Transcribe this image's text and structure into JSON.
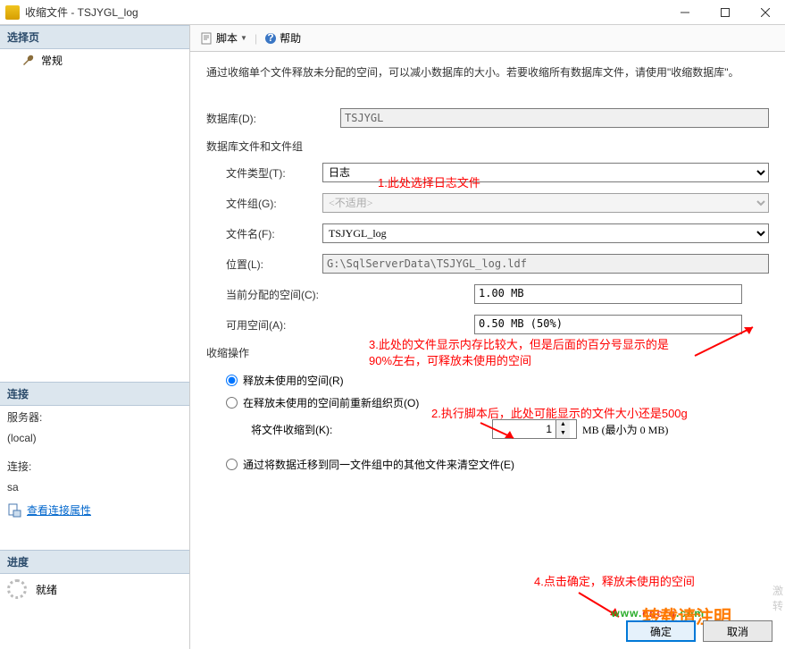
{
  "window": {
    "title": "收缩文件 - TSJYGL_log"
  },
  "left": {
    "select_page": "选择页",
    "general": "常规",
    "connection": "连接",
    "server_lbl": "服务器:",
    "server_val": "(local)",
    "conn_lbl": "连接:",
    "conn_val": "sa",
    "view_props": "查看连接属性",
    "progress": "进度",
    "ready": "就绪"
  },
  "toolbar": {
    "script": "脚本",
    "help": "帮助"
  },
  "form": {
    "desc": "通过收缩单个文件释放未分配的空间，可以减小数据库的大小。若要收缩所有数据库文件，请使用\"收缩数据库\"。",
    "db_lbl": "数据库(D):",
    "db_val": "TSJYGL",
    "group1": "数据库文件和文件组",
    "filetype_lbl": "文件类型(T):",
    "filetype_val": "日志",
    "filegroup_lbl": "文件组(G):",
    "filegroup_val": "<不适用>",
    "filename_lbl": "文件名(F):",
    "filename_val": "TSJYGL_log",
    "location_lbl": "位置(L):",
    "location_val": "G:\\SqlServerData\\TSJYGL_log.ldf",
    "alloc_lbl": "当前分配的空间(C):",
    "alloc_val": "1.00 MB",
    "avail_lbl": "可用空间(A):",
    "avail_val": "0.50 MB (50%)",
    "shrink_ops": "收缩操作",
    "radio1": "释放未使用的空间(R)",
    "radio2": "在释放未使用的空间前重新组织页(O)",
    "shrink_to_lbl": "将文件收缩到(K):",
    "shrink_to_val": "1",
    "mb_txt": "MB (最小为 0 MB)",
    "radio3": "通过将数据迁移到同一文件组中的其他文件来清空文件(E)"
  },
  "annotations": {
    "a1": "1.此处选择日志文件",
    "a2": "2.执行脚本后，此处可能显示的文件大小还是500g",
    "a3": "3.此处的文件显示内存比较大，但是后面的百分号显示的是90%左右，可释放未使用的空间",
    "a4": "4.点击确定，释放未使用的空间"
  },
  "buttons": {
    "ok": "确定",
    "cancel": "取消"
  },
  "watermark": "www.cncrq.com",
  "ov": "转载请注明",
  "activate1": "激",
  "activate2": "转"
}
